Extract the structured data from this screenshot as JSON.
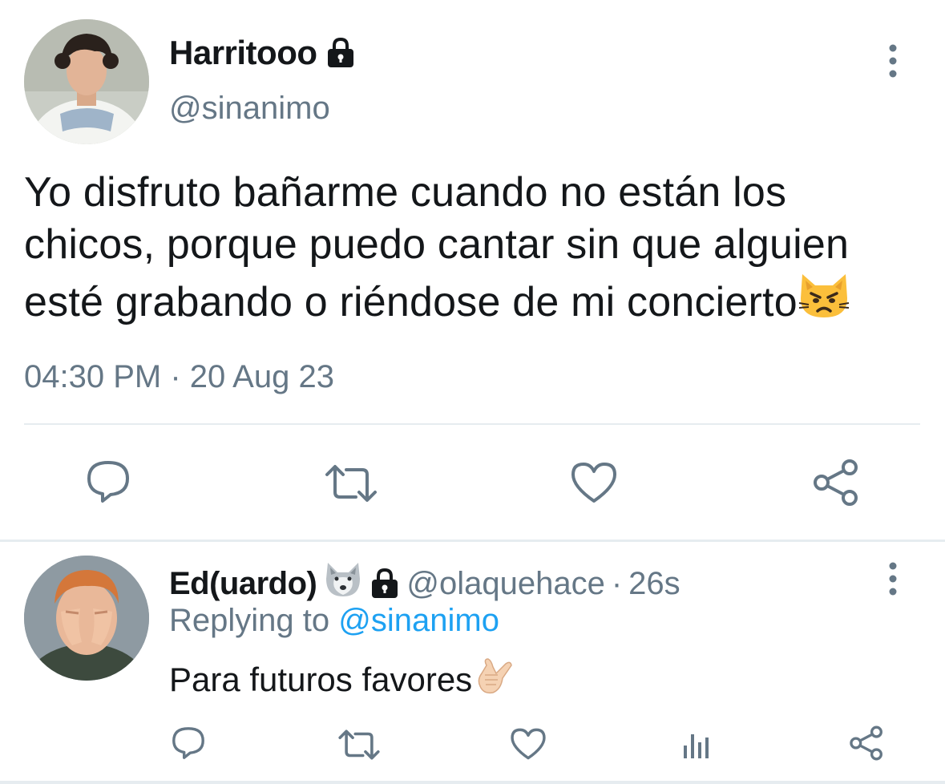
{
  "main_tweet": {
    "display_name": "Harritooo",
    "handle": "@sinanimo",
    "text_lines": [
      "Yo disfruto bañarme cuando no están los",
      "chicos, porque puedo cantar sin que alguien",
      "esté grabando o riéndose de mi concierto"
    ],
    "text_emoji": "pouting-cat",
    "timestamp": "04:30 PM · 20 Aug 23",
    "actions": [
      "reply-icon",
      "retweet-icon",
      "like-icon",
      "share-icon"
    ]
  },
  "reply_tweet": {
    "display_name": "Ed(uardo)",
    "name_emoji": "wolf-face",
    "handle": "@olaquehace",
    "separator": "·",
    "time_ago": "26s",
    "replying_prefix": "Replying to",
    "replying_to": "@sinanimo",
    "text": "Para futuros favores",
    "text_emoji": "call-me-hand",
    "actions": [
      "reply-icon",
      "retweet-icon",
      "like-icon",
      "analytics-icon",
      "share-icon"
    ]
  },
  "colors": {
    "text": "#14171a",
    "muted": "#657786",
    "link": "#1da1f2",
    "divider": "#e6ecf0"
  }
}
